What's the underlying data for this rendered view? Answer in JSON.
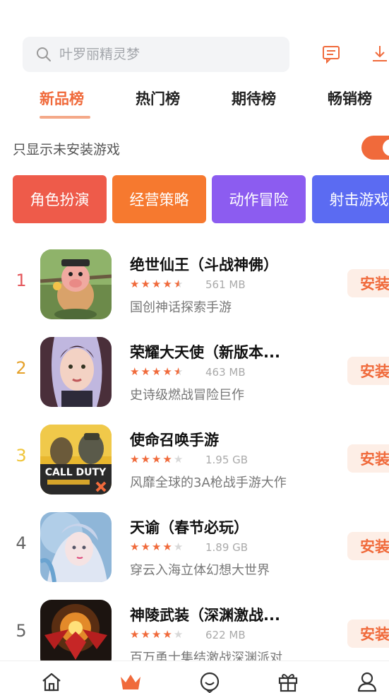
{
  "search": {
    "placeholder": "叶罗丽精灵梦"
  },
  "tabs": [
    {
      "label": "新品榜",
      "active": true
    },
    {
      "label": "热门榜",
      "active": false
    },
    {
      "label": "期待榜",
      "active": false
    },
    {
      "label": "畅销榜",
      "active": false
    }
  ],
  "filter": {
    "label": "只显示未安装游戏",
    "toggle_on": true
  },
  "categories": [
    {
      "label": "角色扮演",
      "color": "#ee5b4a"
    },
    {
      "label": "经营策略",
      "color": "#f6792f"
    },
    {
      "label": "动作冒险",
      "color": "#8c5cf0"
    },
    {
      "label": "射击游戏",
      "color": "#5b6bf2"
    }
  ],
  "games": [
    {
      "rank": "1",
      "rank_color": "#e4565a",
      "title": "绝世仙王（斗战神佛）",
      "rating": 4.5,
      "size": "561 MB",
      "desc": "国创神话探索手游",
      "install_label": "安装"
    },
    {
      "rank": "2",
      "rank_color": "#e5a12a",
      "title": "荣耀大天使（新版本...",
      "rating": 4.5,
      "size": "463 MB",
      "desc": "史诗级燃战冒险巨作",
      "install_label": "安装"
    },
    {
      "rank": "3",
      "rank_color": "#f0c53a",
      "title": "使命召唤手游",
      "rating": 4,
      "size": "1.95 GB",
      "desc": "风靡全球的3A枪战手游大作",
      "install_label": "安装"
    },
    {
      "rank": "4",
      "rank_color": "#666666",
      "title": "天谕（春节必玩）",
      "rating": 4,
      "size": "1.89 GB",
      "desc": "穿云入海立体幻想大世界",
      "install_label": "安装"
    },
    {
      "rank": "5",
      "rank_color": "#666666",
      "title": "神陵武装（深渊激战...",
      "rating": 4,
      "size": "622 MB",
      "desc": "百万勇士集结激战深渊派对",
      "install_label": "安装"
    }
  ],
  "game_thumb_text": {
    "cod": "CALL DUTY"
  },
  "bottom_nav": [
    {
      "icon": "home-icon",
      "active": false
    },
    {
      "icon": "crown-icon",
      "active": true
    },
    {
      "icon": "smiley-icon",
      "active": false
    },
    {
      "icon": "gift-icon",
      "active": false
    },
    {
      "icon": "user-icon",
      "active": false
    }
  ],
  "colors": {
    "accent": "#f06a3b",
    "install_bg": "#fdeee6"
  }
}
